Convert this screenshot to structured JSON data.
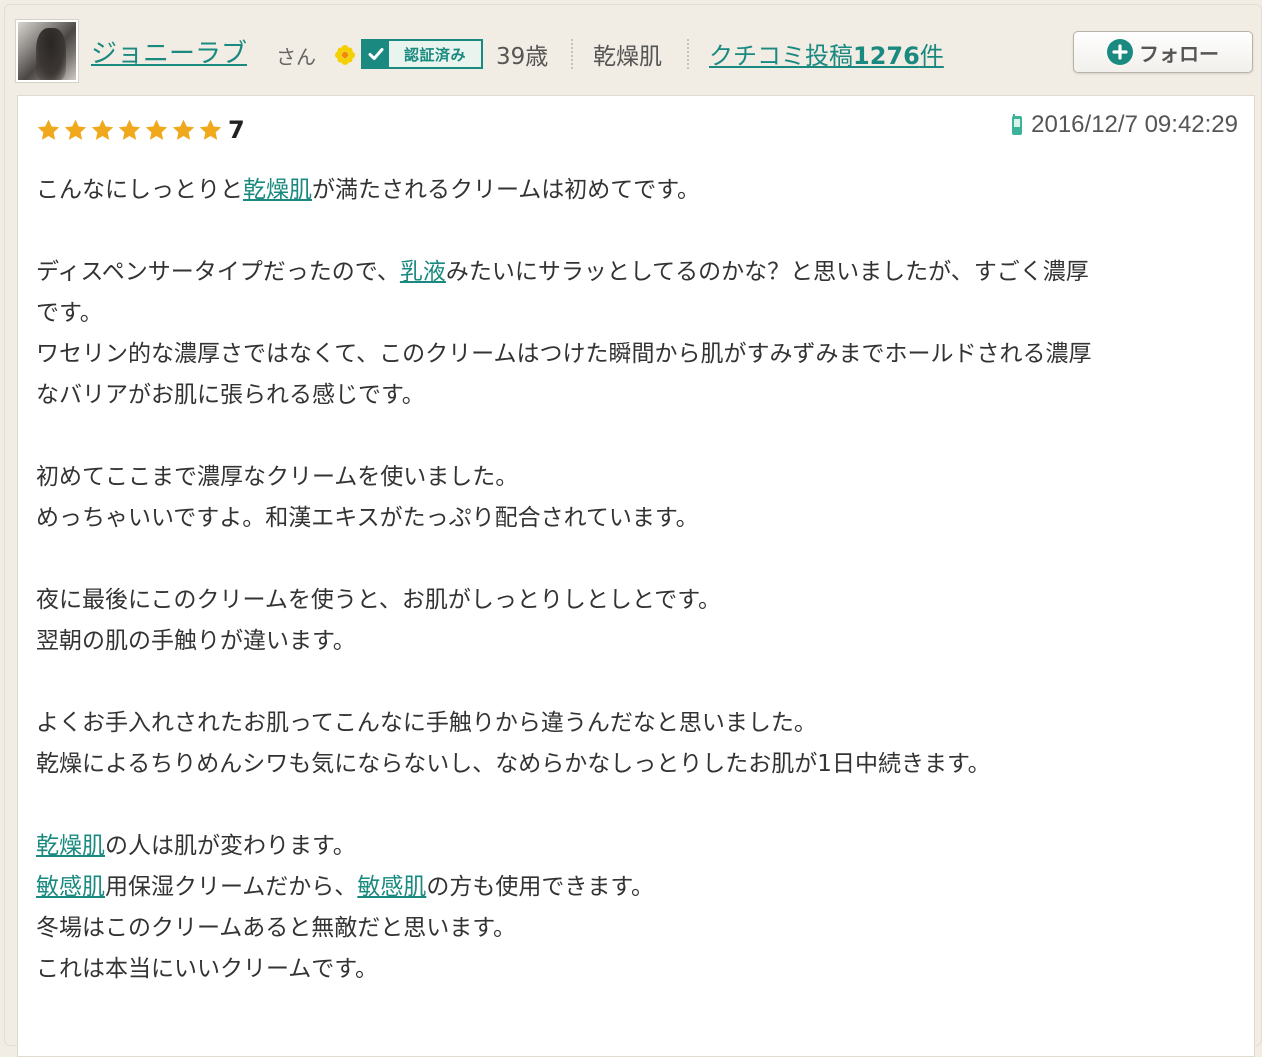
{
  "user": {
    "name": "ジョニーラブ",
    "honorific": "さん",
    "verified_label": "認証済み",
    "age": "39歳",
    "skin_type": "乾燥肌",
    "review_count_prefix": "クチコミ投稿",
    "review_count_number": "1276",
    "review_count_suffix": "件",
    "follow_label": "フォロー"
  },
  "review": {
    "rating": "7",
    "stars_filled": 7,
    "date": "2016/12/7 09:42:29",
    "paragraphs": [
      [
        [
          {
            "t": "こんなにしっとりと"
          },
          {
            "t": "乾燥肌",
            "link": true
          },
          {
            "t": "が満たされるクリームは初めてです。"
          }
        ]
      ],
      [
        [
          {
            "t": "ディスペンサータイプだったので、"
          },
          {
            "t": "乳液",
            "link": true
          },
          {
            "t": "みたいにサラッとしてるのかな？と思いましたが、すごく濃厚"
          }
        ],
        [
          {
            "t": "です。"
          }
        ],
        [
          {
            "t": "ワセリン的な濃厚さではなくて、このクリームはつけた瞬間から肌がすみずみまでホールドされる濃厚"
          }
        ],
        [
          {
            "t": "なバリアがお肌に張られる感じです。"
          }
        ]
      ],
      [
        [
          {
            "t": "初めてここまで濃厚なクリームを使いました。"
          }
        ],
        [
          {
            "t": "めっちゃいいですよ。和漢エキスがたっぷり配合されています。"
          }
        ]
      ],
      [
        [
          {
            "t": "夜に最後にこのクリームを使うと、お肌がしっとりしとしとです。"
          }
        ],
        [
          {
            "t": "翌朝の肌の手触りが違います。"
          }
        ]
      ],
      [
        [
          {
            "t": "よくお手入れされたお肌ってこんなに手触りから違うんだなと思いました。"
          }
        ],
        [
          {
            "t": "乾燥によるちりめんシワも気にならないし、なめらかなしっとりしたお肌が1日中続きます。"
          }
        ]
      ],
      [
        [
          {
            "t": "乾燥肌",
            "link": true
          },
          {
            "t": "の人は肌が変わります。"
          }
        ],
        [
          {
            "t": "敏感肌",
            "link": true
          },
          {
            "t": "用保湿クリームだから、"
          },
          {
            "t": "敏感肌",
            "link": true
          },
          {
            "t": "の方も使用できます。"
          }
        ],
        [
          {
            "t": "冬場はこのクリームあると無敵だと思います。"
          }
        ],
        [
          {
            "t": "これは本当にいいクリームです。"
          }
        ]
      ]
    ]
  },
  "colors": {
    "accent": "#1a8a80",
    "star": "#f0a81c",
    "background": "#f1ece4"
  },
  "icons": {
    "flower": "yellow-flower-icon",
    "verified": "checkmark-icon",
    "follow": "plus-circle-icon",
    "star": "star-icon",
    "device": "mobile-phone-icon"
  }
}
